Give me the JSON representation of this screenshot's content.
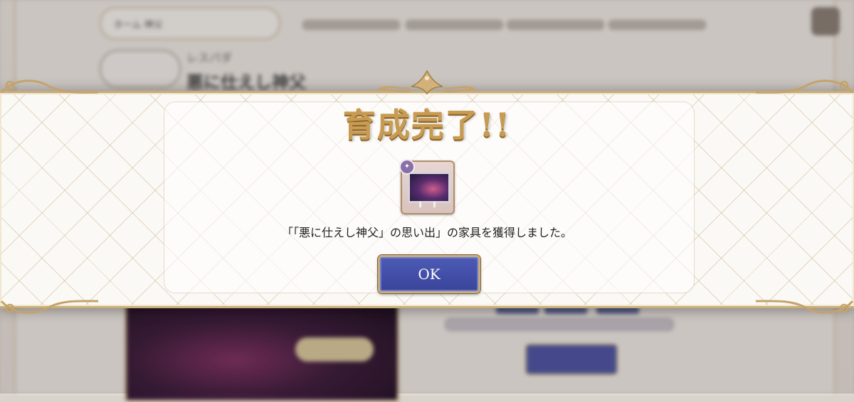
{
  "background": {
    "character_title_line1": "レスパダ",
    "character_title_line2": "悪に仕えし神父",
    "pill_label": "ホーム 神父"
  },
  "dialog": {
    "title": "育成完了!!",
    "message": "「「悪に仕えし神父」の思い出」の家具を獲得しました。",
    "ok_label": "OK",
    "item_icon": "furniture-monitor-icon"
  },
  "colors": {
    "title_gold": "#c79b52",
    "button_blue": "#3a449a",
    "frame_gold": "#c9ad7a"
  }
}
